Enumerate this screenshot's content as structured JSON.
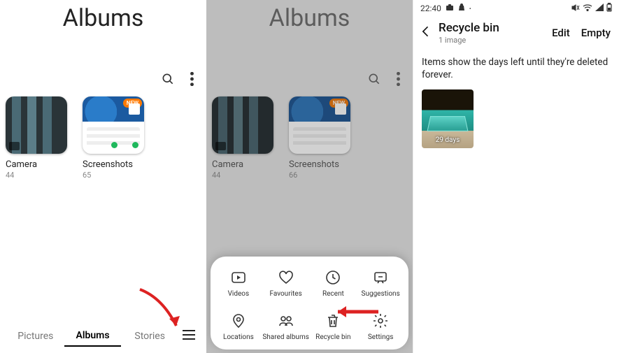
{
  "panel1": {
    "title": "Albums",
    "albums": [
      {
        "name": "Camera",
        "count": "44"
      },
      {
        "name": "Screenshots",
        "count": "65",
        "badge": "NEW"
      }
    ],
    "tabs": [
      "Pictures",
      "Albums",
      "Stories"
    ],
    "active_tab": "Albums"
  },
  "panel2": {
    "title": "Albums",
    "albums": [
      {
        "name": "Camera",
        "count": "44"
      },
      {
        "name": "Screenshots",
        "count": "66",
        "badge": "NEW"
      }
    ],
    "sheet_items": [
      {
        "key": "videos",
        "label": "Videos"
      },
      {
        "key": "favourites",
        "label": "Favourites"
      },
      {
        "key": "recent",
        "label": "Recent"
      },
      {
        "key": "suggestions",
        "label": "Suggestions"
      },
      {
        "key": "locations",
        "label": "Locations"
      },
      {
        "key": "shared",
        "label": "Shared albums"
      },
      {
        "key": "recyclebin",
        "label": "Recycle bin"
      },
      {
        "key": "settings",
        "label": "Settings"
      }
    ]
  },
  "panel3": {
    "status_time": "22:40",
    "header_title": "Recycle bin",
    "header_sub": "1 image",
    "action_edit": "Edit",
    "action_empty": "Empty",
    "info_text": "Items show the days left until they're deleted forever.",
    "thumb_days": "29 days"
  }
}
